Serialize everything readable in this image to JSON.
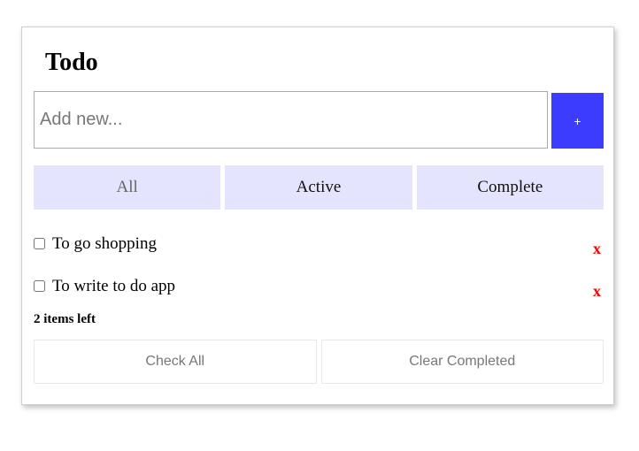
{
  "app": {
    "title": "Todo"
  },
  "new_todo": {
    "placeholder": "Add new...",
    "value": "",
    "add_label": "+"
  },
  "filters": [
    {
      "label": "All",
      "selected": true
    },
    {
      "label": "Active",
      "selected": false
    },
    {
      "label": "Complete",
      "selected": false
    }
  ],
  "todos": [
    {
      "label": "To go shopping",
      "completed": false,
      "delete_label": "x"
    },
    {
      "label": "To write to do app",
      "completed": false,
      "delete_label": "x"
    }
  ],
  "footer": {
    "items_left": "2 items left",
    "check_all_label": "Check All",
    "clear_completed_label": "Clear Completed"
  },
  "colors": {
    "accent": "#3c3cff",
    "filter_bg": "#e4e4ff",
    "delete": "#ff0000"
  }
}
